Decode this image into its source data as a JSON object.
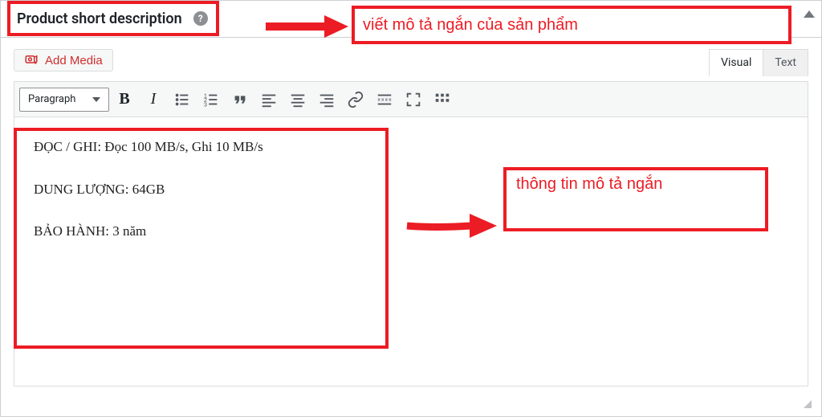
{
  "panel": {
    "title": "Product short description",
    "help_tooltip": "?"
  },
  "buttons": {
    "add_media": "Add Media"
  },
  "tabs": {
    "visual": "Visual",
    "text": "Text",
    "active": "visual"
  },
  "toolbar": {
    "format_selector": "Paragraph",
    "buttons": [
      {
        "name": "bold-icon"
      },
      {
        "name": "italic-icon"
      },
      {
        "name": "bullet-list-icon"
      },
      {
        "name": "numbered-list-icon"
      },
      {
        "name": "blockquote-icon"
      },
      {
        "name": "align-left-icon"
      },
      {
        "name": "align-center-icon"
      },
      {
        "name": "align-right-icon"
      },
      {
        "name": "link-icon"
      },
      {
        "name": "insert-more-icon"
      },
      {
        "name": "fullscreen-icon"
      },
      {
        "name": "toolbar-toggle-icon"
      }
    ]
  },
  "content": {
    "lines": [
      "ĐỌC / GHI: Đọc 100 MB/s, Ghi 10 MB/s",
      "DUNG LƯỢNG: 64GB",
      "BẢO HÀNH: 3 năm"
    ]
  },
  "annotations": {
    "header_note": "viết mô tả ngắn của sản phẩm",
    "content_note": "thông tin mô tả ngắn"
  },
  "colors": {
    "annotation_red": "#ec1c24",
    "toolbar_bg": "#f6f7f7",
    "border": "#dcdcde"
  }
}
